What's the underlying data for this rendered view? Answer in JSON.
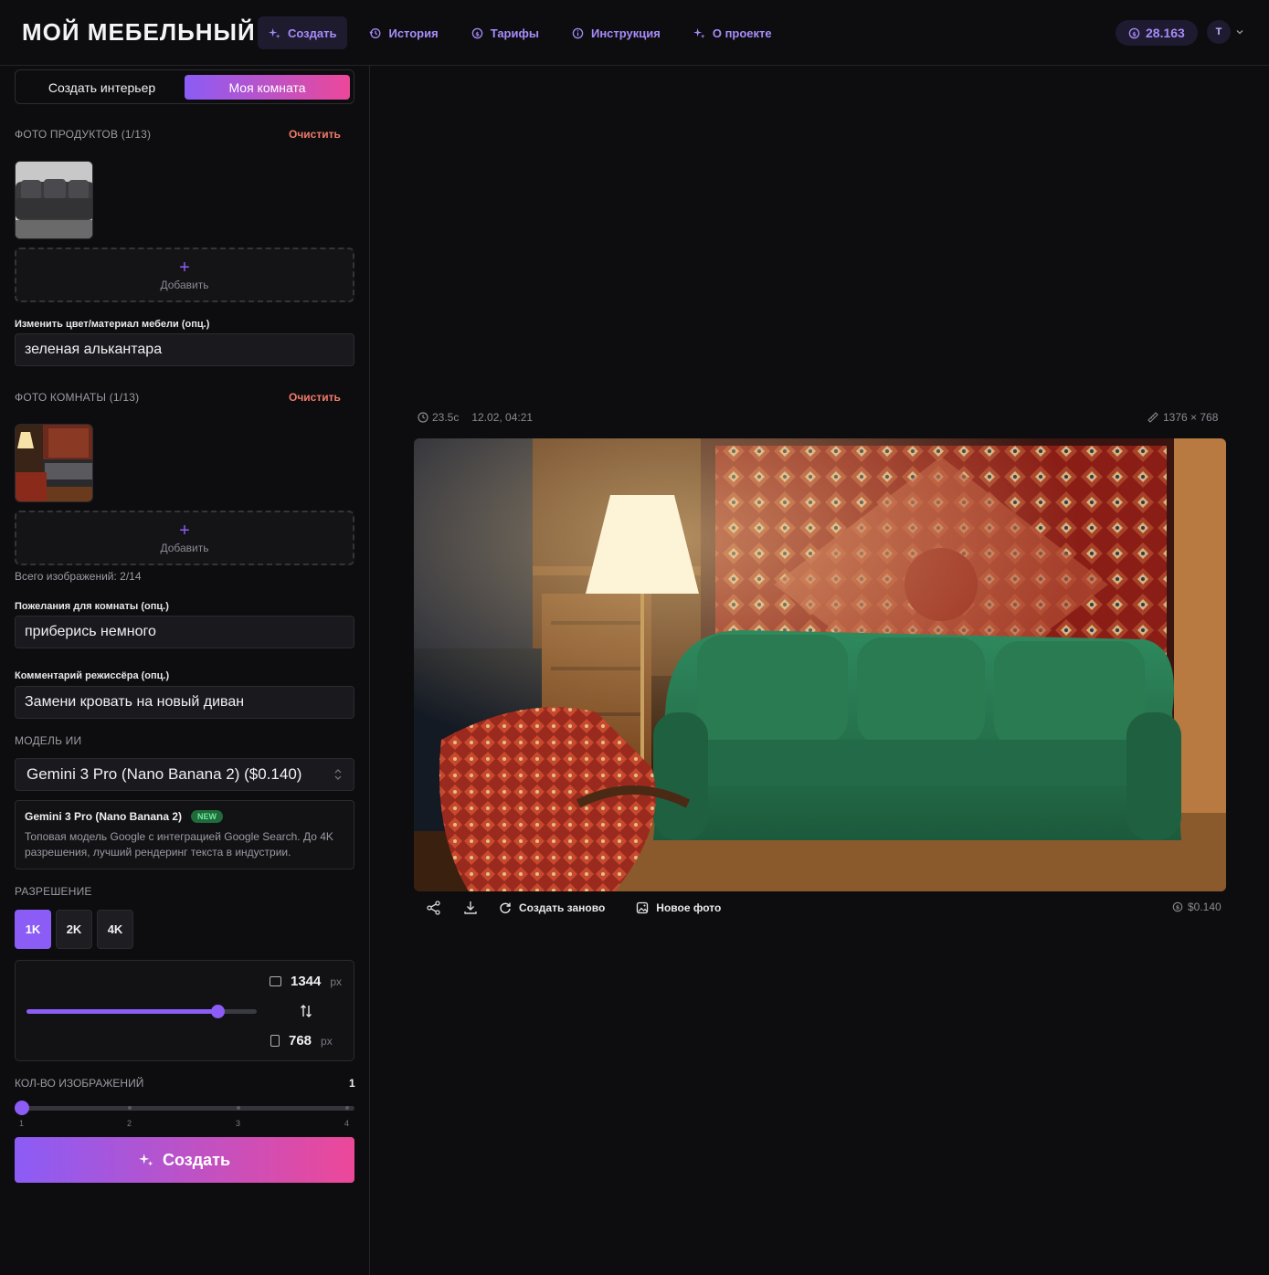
{
  "header": {
    "brand": "МОЙ МЕБЕЛЬНЫЙ",
    "nav": [
      {
        "label": "Создать",
        "icon": "sparkles-icon",
        "active": true
      },
      {
        "label": "История",
        "icon": "history-icon"
      },
      {
        "label": "Тарифы",
        "icon": "coin-icon"
      },
      {
        "label": "Инструкция",
        "icon": "info-icon"
      },
      {
        "label": "О проекте",
        "icon": "sparkles-icon"
      }
    ],
    "balance": "28.163",
    "avatar": "T"
  },
  "sidebar": {
    "tabs": [
      "Создать интерьер",
      "Моя комната"
    ],
    "products": {
      "label": "ФОТО ПРОДУКТОВ (1/13)",
      "clear": "Очистить",
      "add": "Добавить"
    },
    "material": {
      "label": "Изменить цвет/материал мебели (опц.)",
      "value": "зеленая алькантара"
    },
    "room": {
      "label": "ФОТО КОМНАТЫ (1/13)",
      "clear": "Очистить",
      "add": "Добавить"
    },
    "total": "Всего изображений: 2/14",
    "wishes": {
      "label": "Пожелания для комнаты (опц.)",
      "value": "приберись немного"
    },
    "director": {
      "label": "Комментарий режиссёра (опц.)",
      "value": "Замени кровать на новый диван"
    },
    "model": {
      "label": "МОДЕЛЬ ИИ",
      "selected": "Gemini 3 Pro (Nano Banana 2) ($0.140)",
      "card_title": "Gemini 3 Pro (Nano Banana 2)",
      "badge": "NEW",
      "description": "Топовая модель Google с интеграцией Google Search. До 4K разрешения, лучший рендеринг текста в индустрии."
    },
    "resolution": {
      "label": "РАЗРЕШЕНИЕ",
      "options": [
        "1K",
        "2K",
        "4K"
      ],
      "selected": "1K",
      "width": "1344",
      "height": "768",
      "unit": "px",
      "aspect_slider_fraction": 0.83
    },
    "count": {
      "label": "КОЛ-ВО ИЗОБРАЖЕНИЙ",
      "value": "1",
      "ticks": [
        "1",
        "2",
        "3",
        "4"
      ]
    },
    "create": "Создать"
  },
  "result": {
    "duration": "23.5с",
    "timestamp": "12.02, 04:21",
    "size": "1376 × 768",
    "actions": {
      "regenerate": "Создать заново",
      "new_photo": "Новое фото"
    },
    "cost": "$0.140"
  },
  "colors": {
    "accent": "#8b5cf6",
    "gradient_end": "#ec4899",
    "background": "#0d0d0f",
    "clear_link": "#f07a6a"
  }
}
